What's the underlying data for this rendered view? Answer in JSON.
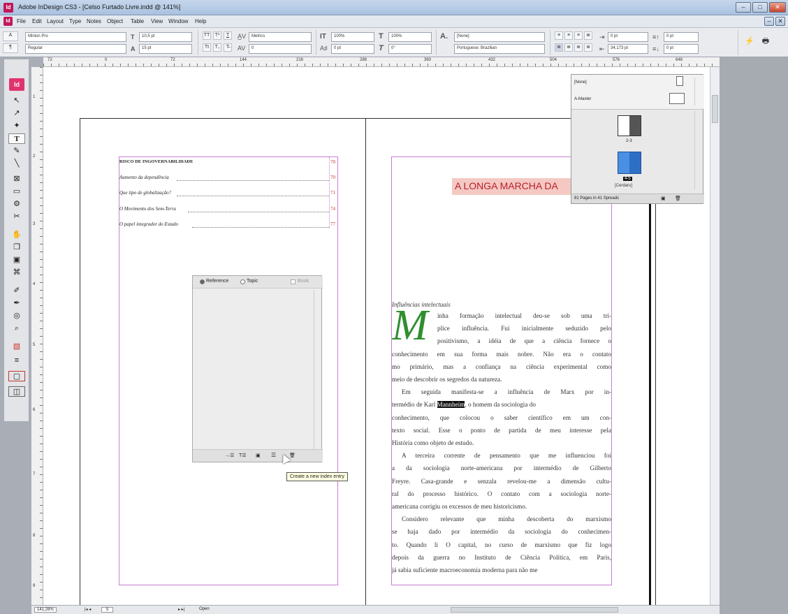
{
  "titlebar": {
    "app_icon": "Id",
    "title": "Adobe InDesign CS3 - [Celso Furtado Livre.indd @ 141%]",
    "minimize": "–",
    "maximize": "□",
    "close": "✕"
  },
  "menubar": {
    "items": [
      "File",
      "Edit",
      "Layout",
      "Type",
      "Notes",
      "Object",
      "Table",
      "View",
      "Window",
      "Help"
    ],
    "doc_min": "–",
    "doc_close": "✕"
  },
  "control": {
    "font_family": "Minion Pro",
    "font_style": "Regular",
    "font_size": "10,5 pt",
    "leading": "15 pt",
    "tracking_label": "Metrics",
    "tracking": "0",
    "vscale": "100%",
    "hscale": "100%",
    "baseline": "0 pt",
    "skew": "0°",
    "char_style": "[None]",
    "language": "Portuguese: Brazilian",
    "indent_l": "0 pt",
    "indent_r": "34,173 pt",
    "space_b": "0 pt",
    "space_a": "0 pt",
    "tt": "TT",
    "ts": "T¹",
    "tu": "T",
    "tsub": "T₁",
    "tstrike": "T̶"
  },
  "ruler": {
    "h": [
      "72",
      "0",
      "72",
      "144",
      "216",
      "288",
      "360",
      "432",
      "504",
      "576",
      "648"
    ],
    "v": [
      "1",
      "2",
      "3",
      "4",
      "5",
      "6",
      "7",
      "8",
      "9",
      "10"
    ]
  },
  "tools": [
    "↖",
    "↗",
    "✦",
    "T",
    "✎",
    "╲",
    "⊠",
    "▭",
    "⚙",
    "✂",
    "✋",
    "❐",
    "▣",
    "⌘",
    "✐",
    "✒",
    "◎",
    "⌕",
    "▧",
    "≡",
    "▢",
    "◫"
  ],
  "left_page": {
    "heading": "RISCO DE INGOVERNABILIDADE",
    "entries": [
      {
        "text": "Aumento da dependência",
        "num": "70"
      },
      {
        "text": "Que tipo de globalização?",
        "num": "71"
      },
      {
        "text": "O Movimento dos Sem-Terra",
        "num": "74"
      },
      {
        "text": "O papel integrador do Estado",
        "num": "77"
      }
    ],
    "heading_num": "70"
  },
  "index_panel": {
    "reference": "Reference",
    "topic": "Topic",
    "book": "Book",
    "bottom_buttons": [
      "→☰",
      "T☰",
      "▣",
      "☰",
      "🗑"
    ],
    "tooltip": "Create a new index entry"
  },
  "right_page": {
    "title": "A LONGA MARCHA DA",
    "subhead": "Influências intelectuais",
    "dropcap": "M",
    "lines": [
      "inha formação intelectual deu-se sob uma trí-",
      "plice influência. Fui inicialmente seduzido pelo",
      "positivismo, a idéia de que a ciência fornece o",
      "conhecimento em sua forma mais nobre. Não era o contato",
      "mo primário, mas a confiança na ciência experimental como",
      "meio de descobrir os segredos da natureza.",
      "Em seguida manifesta-se a influência de Marx por in-",
      "termédio de Karl ",
      "conhecimento, que colocou o saber científico em um con-",
      "texto social. Esse o ponto de partida de meu interesse pela",
      "História como objeto de estudo.",
      "A terceira corrente de pensamento que me influenciou foi",
      "a da sociologia norte-americana por intermédio de Gilberto",
      "Freyre. Casa-grande e senzala revelou-me a dimensão cultu-",
      "ral do processo histórico. O contato com a sociologia norte-",
      "americana corrigiu os excessos de meu historicismo.",
      "Considero relevante que minha descoberta do marxismo",
      "se haja dado por intermédio da sociologia do conhecimen-",
      "to. Quando li O capital, no curso de marxismo que fiz logo",
      "depois da guerra no Instituto de Ciência Política, em Paris,",
      "já sabia suficiente macroeconomia moderna para não me"
    ],
    "highlight": "Mannheim",
    "after_highlight": ", o homem da sociologia do"
  },
  "pages_panel": {
    "none": "[None]",
    "master": "A-Master",
    "spread1": "2-3",
    "spread2": "4-5",
    "footer": "81 Pages in 41 Spreads",
    "tooltip": "[Cerdaru]"
  },
  "status": {
    "zoom": "141,28%",
    "page": "5",
    "state": "Open"
  }
}
